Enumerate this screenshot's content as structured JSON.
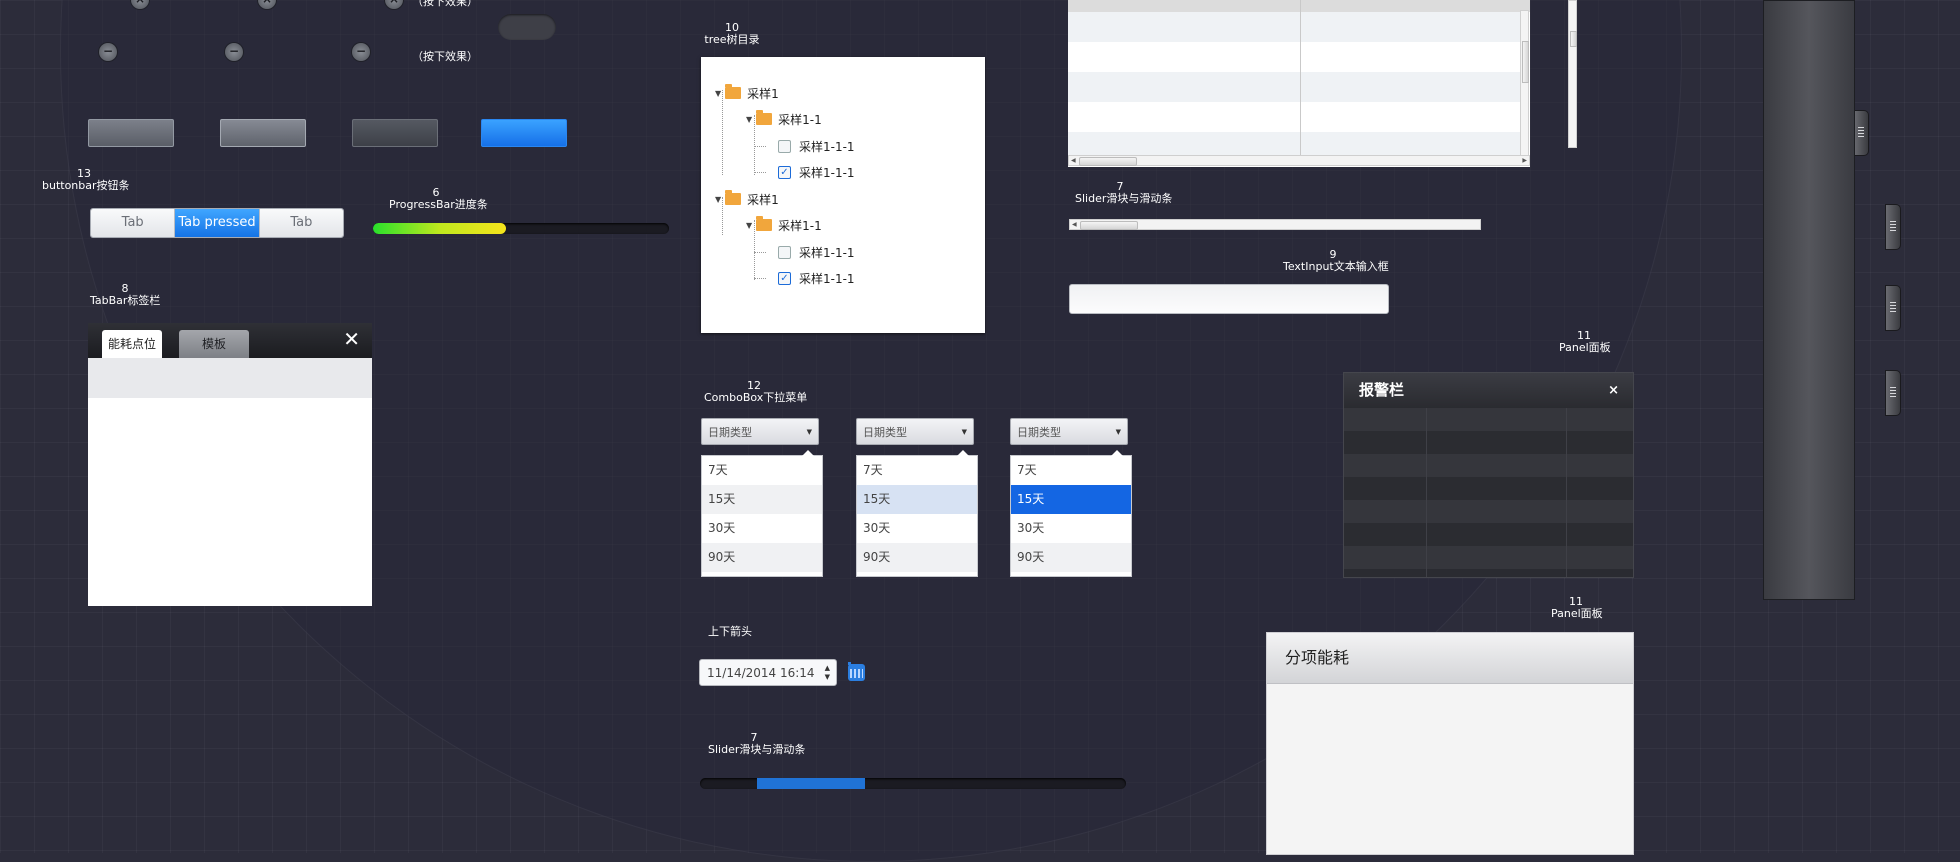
{
  "labels": {
    "pressed_hint_top": "（按下效果）",
    "pressed_hint": "（按下效果）",
    "buttonbar_num": "13",
    "buttonbar_name": "buttonbar按钮条",
    "progress_num": "6",
    "progress_name": "ProgressBar进度条",
    "tabbar_num": "8",
    "tabbar_name": "TabBar标签栏",
    "tree_num": "10",
    "tree_name": "tree树目录",
    "combo_num": "12",
    "combo_name": "ComboBox下拉菜单",
    "updown_name": "上下箭头",
    "slider_bottom_num": "7",
    "slider_bottom_name": "Slider滑块与滑动条",
    "slider_top_num": "7",
    "slider_top_name": "Slider滑块与滑动条",
    "textinput_num": "9",
    "textinput_name": "TextInput文本输入框",
    "panel_top_num": "11",
    "panel_top_name": "Panel面板",
    "panel_bottom_num": "11",
    "panel_bottom_name": "Panel面板"
  },
  "buttonbar": {
    "tabs": [
      "Tab",
      "Tab pressed",
      "Tab"
    ]
  },
  "progress": {
    "value": 0.45,
    "colors": [
      "#29e02c",
      "#f6e41c"
    ]
  },
  "tabbar": {
    "tabs": [
      "能耗点位",
      "模板"
    ],
    "close": "✕"
  },
  "tree": {
    "nodes": [
      {
        "label": "采样1"
      },
      {
        "label": "采样1-1"
      },
      {
        "label": "采样1-1-1",
        "checked": false
      },
      {
        "label": "采样1-1-1",
        "checked": true
      },
      {
        "label": "采样1"
      },
      {
        "label": "采样1-1"
      },
      {
        "label": "采样1-1-1",
        "checked": false
      },
      {
        "label": "采样1-1-1",
        "checked": true
      }
    ]
  },
  "combos": [
    {
      "value": "日期类型",
      "options": [
        "7天",
        "15天",
        "30天",
        "90天"
      ]
    },
    {
      "value": "日期类型",
      "options": [
        "7天",
        "15天",
        "30天",
        "90天"
      ]
    },
    {
      "value": "日期类型",
      "options": [
        "7天",
        "15天",
        "30天",
        "90天"
      ]
    }
  ],
  "date": {
    "value": "11/14/2014   16:14"
  },
  "panels": {
    "alarm_title": "报警栏",
    "alarm_close": "×",
    "energy_title": "分项能耗"
  },
  "icons": [
    "close-icon",
    "minus-icon",
    "folder-icon",
    "checkbox-icon",
    "calendar-icon",
    "spinner-icon",
    "drag-handle-icon"
  ],
  "colors": {
    "background": "#2c2c3a",
    "accent": "#1573e6",
    "selected": "#1466e3"
  }
}
